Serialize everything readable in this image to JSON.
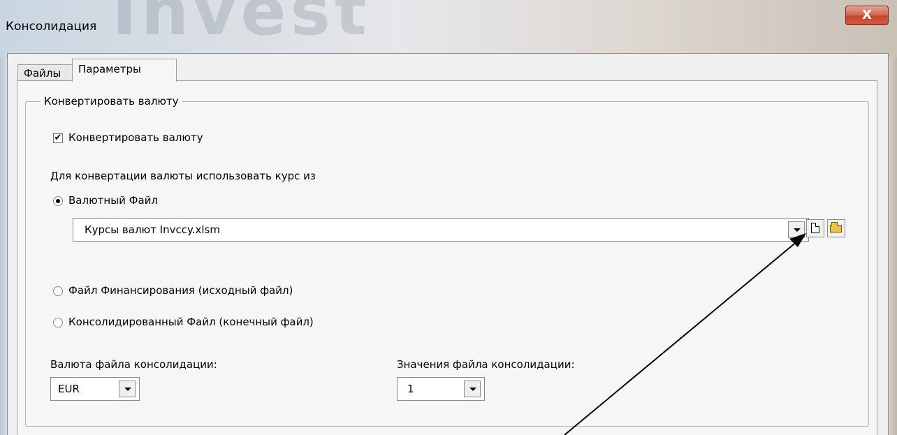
{
  "window": {
    "title": "Консолидация",
    "watermark": "Invest",
    "close_label": "X"
  },
  "tabs": [
    {
      "label": "Файлы",
      "active": false
    },
    {
      "label": "Параметры",
      "active": true
    }
  ],
  "group": {
    "legend": "Конвертировать валюту",
    "convert_checkbox_label": "Конвертировать валюту",
    "convert_checked": true,
    "rate_source_heading": "Для конвертации валюты использовать курс из",
    "radio_currency_file": "Валютный Файл",
    "currency_file_value": "Курсы валют Invccy.xlsm",
    "radio_funding_file": "Файл Финансирования (исходный файл)",
    "radio_consolidated_file": "Консолидированный Файл (конечный файл)",
    "selected_source": "currency_file"
  },
  "consolidation": {
    "currency_label": "Валюта файла консолидации:",
    "currency_value": "EUR",
    "values_label": "Значения файла консолидации:",
    "values_value": "1"
  },
  "icons": {
    "new_file": "new-file-icon",
    "open_folder": "open-folder-icon",
    "check": "✔"
  }
}
